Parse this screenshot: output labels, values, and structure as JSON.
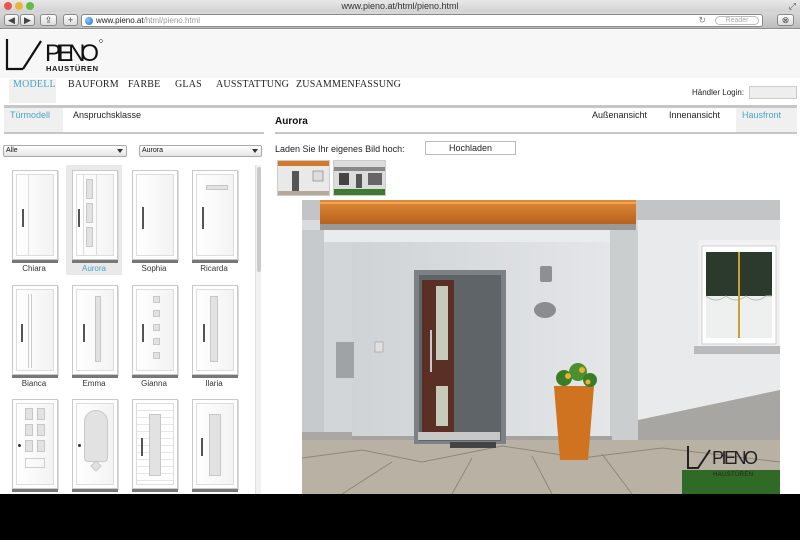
{
  "window": {
    "title": "www.pieno.at/html/pieno.html",
    "url_host": "www.pieno.at",
    "url_path": "/html/pieno.html",
    "reader_label": "Reader"
  },
  "brand": {
    "logo_text": "PIENO",
    "logo_sub": "HAUSTÜREN",
    "watermark_text": "PIENO",
    "watermark_sub": "HAUSTÜREN"
  },
  "nav": {
    "items": [
      {
        "label": "MODELL",
        "active": true
      },
      {
        "label": "BAUFORM",
        "active": false
      },
      {
        "label": "FARBE",
        "active": false
      },
      {
        "label": "GLAS",
        "active": false
      },
      {
        "label": "AUSSTATTUNG",
        "active": false
      },
      {
        "label": "ZUSAMMENFASSUNG",
        "active": false
      }
    ],
    "dealer_login_label": "Händler Login:",
    "dealer_login_value": ""
  },
  "left": {
    "tabs": [
      {
        "label": "Türmodell",
        "active": true
      },
      {
        "label": "Anspruchsklasse",
        "active": false
      }
    ],
    "filter_select": "Alle",
    "model_select": "Aurora",
    "doors": [
      {
        "name": "Chiara",
        "selected": false
      },
      {
        "name": "Aurora",
        "selected": true
      },
      {
        "name": "Sophia",
        "selected": false
      },
      {
        "name": "Ricarda",
        "selected": false
      },
      {
        "name": "Bianca",
        "selected": false
      },
      {
        "name": "Emma",
        "selected": false
      },
      {
        "name": "Gianna",
        "selected": false
      },
      {
        "name": "Ilaria",
        "selected": false
      },
      {
        "name": "",
        "selected": false
      },
      {
        "name": "",
        "selected": false
      },
      {
        "name": "",
        "selected": false
      },
      {
        "name": "",
        "selected": false
      }
    ]
  },
  "right": {
    "title": "Aurora",
    "view_tabs": [
      {
        "label": "Außenansicht",
        "active": false
      },
      {
        "label": "Innenansicht",
        "active": false
      },
      {
        "label": "Hausfront",
        "active": true
      }
    ],
    "upload_label": "Laden Sie Ihr eigenes Bild hoch:",
    "upload_button": "Hochladen"
  },
  "colors": {
    "accent": "#4ba3c8",
    "door_panel": "#5e6468",
    "door_glass_frame": "#5a2f25",
    "canopy": "#d37a2a",
    "planter": "#d07320",
    "separator": "#c6c6c6"
  }
}
